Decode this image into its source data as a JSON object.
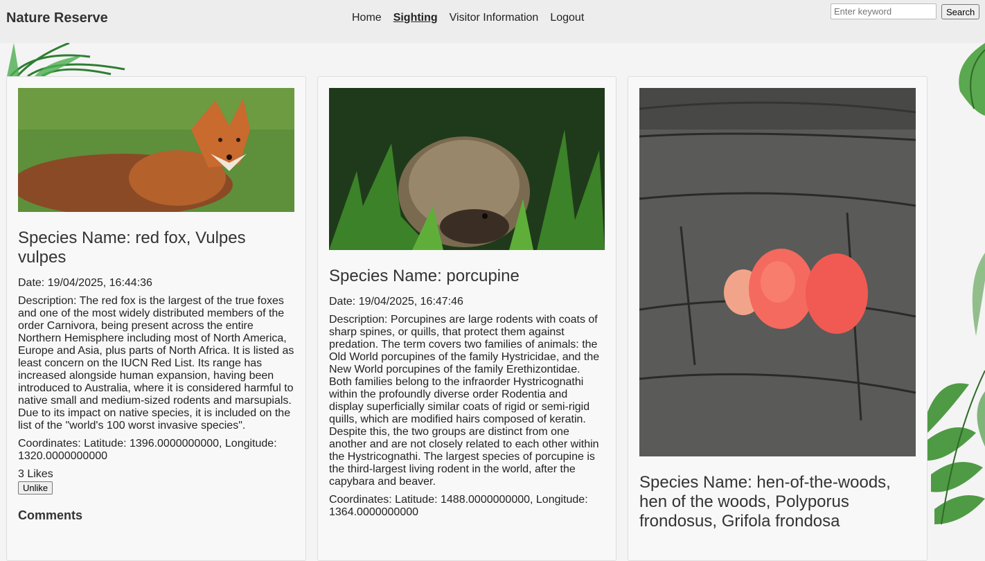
{
  "header": {
    "brand": "Nature Reserve",
    "nav": [
      "Home",
      "Sighting",
      "Visitor Information",
      "Logout"
    ],
    "search_placeholder": "Enter keyword",
    "search_button": "Search"
  },
  "sightings": [
    {
      "species": "Species Name: red fox, Vulpes vulpes",
      "date": "Date: 19/04/2025, 16:44:36",
      "description": "Description: The red fox is the largest of the true foxes and one of the most widely distributed members of the order Carnivora, being present across the entire Northern Hemisphere including most of North America, Europe and Asia, plus parts of North Africa. It is listed as least concern on the IUCN Red List. Its range has increased alongside human expansion, having been introduced to Australia, where it is considered harmful to native small and medium-sized rodents and marsupials. Due to its impact on native species, it is included on the list of the \"world's 100 worst invasive species\".",
      "coordinates": "Coordinates: Latitude: 1396.0000000000, Longitude: 1320.0000000000",
      "likes": "3 Likes",
      "like_button": "Unlike",
      "comments_title": "Comments"
    },
    {
      "species": "Species Name: porcupine",
      "date": "Date: 19/04/2025, 16:47:46",
      "description": "Description: Porcupines are large rodents with coats of sharp spines, or quills, that protect them against predation. The term covers two families of animals: the Old World porcupines of the family Hystricidae, and the New World porcupines of the family Erethizontidae. Both families belong to the infraorder Hystricognathi within the profoundly diverse order Rodentia and display superficially similar coats of rigid or semi-rigid quills, which are modified hairs composed of keratin. Despite this, the two groups are distinct from one another and are not closely related to each other within the Hystricognathi. The largest species of porcupine is the third-largest living rodent in the world, after the capybara and beaver.",
      "coordinates": "Coordinates: Latitude: 1488.0000000000, Longitude: 1364.0000000000"
    },
    {
      "species": "Species Name: hen-of-the-woods, hen of the woods, Polyporus frondosus, Grifola frondosa"
    }
  ]
}
